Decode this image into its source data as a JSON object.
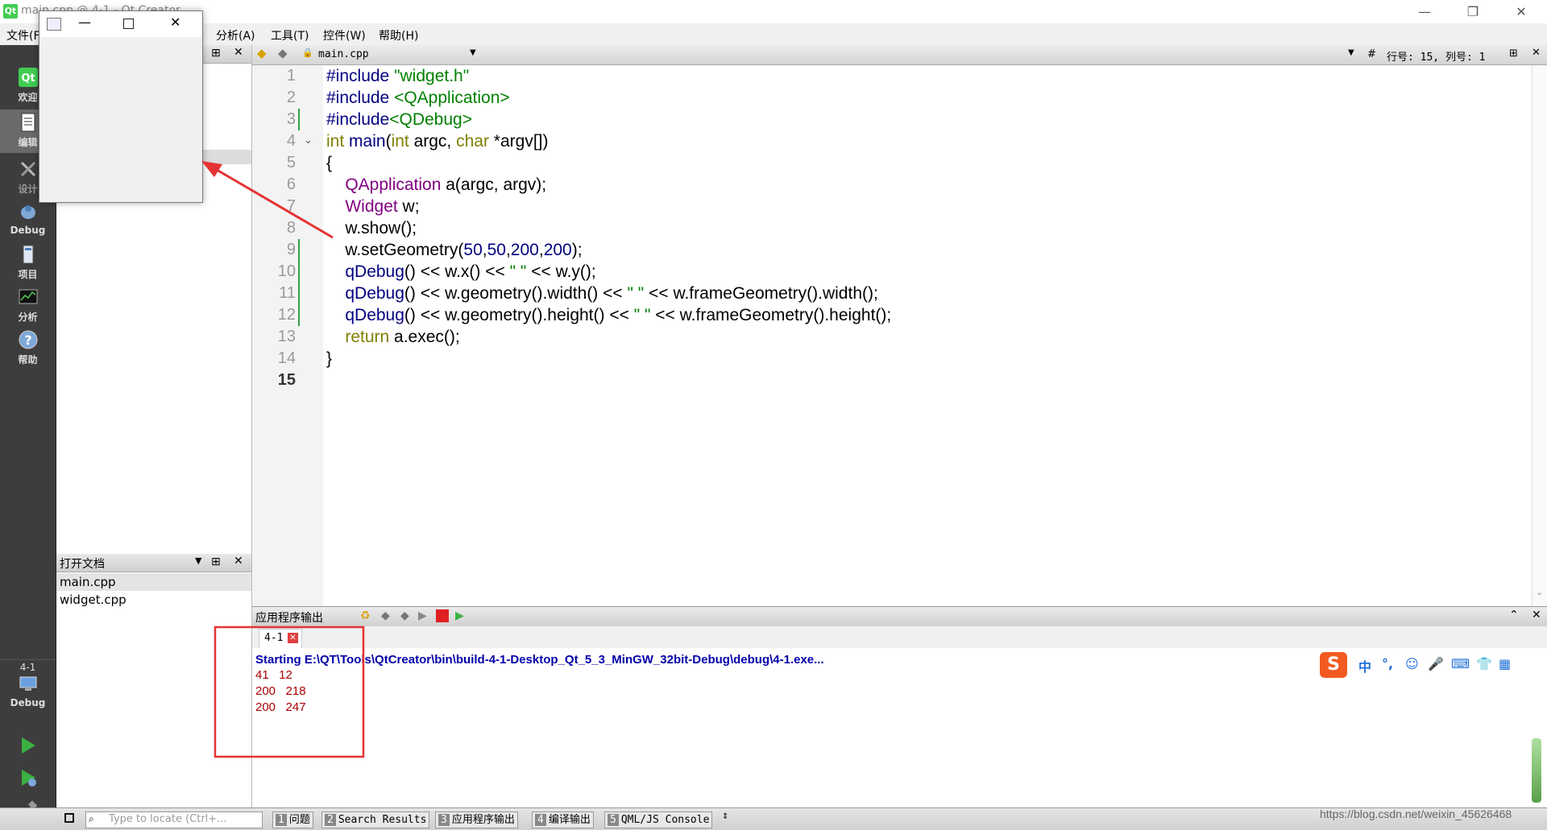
{
  "titlebar": {
    "title": "main.cpp @ 4-1 - Qt Creator",
    "minimize": "—",
    "restore": "❐",
    "close": "✕"
  },
  "menubar": {
    "items": [
      "文件(F)",
      "分析(A)",
      "工具(T)",
      "控件(W)",
      "帮助(H)"
    ]
  },
  "modebar": {
    "modes": [
      "欢迎",
      "编辑",
      "设计",
      "Debug",
      "项目",
      "分析",
      "帮助"
    ],
    "active": "编辑",
    "target": {
      "project": "4-1",
      "config": "Debug"
    }
  },
  "sidebar": {
    "open_docs_title": "打开文档",
    "open_docs": [
      "main.cpp",
      "widget.cpp"
    ]
  },
  "editor": {
    "file_name": "main.cpp",
    "cursor_label": "行号: 15, 列号: 1",
    "line_numbers": [
      "1",
      "2",
      "3",
      "4",
      "5",
      "6",
      "7",
      "8",
      "9",
      "10",
      "11",
      "12",
      "13",
      "14",
      "15"
    ]
  },
  "output": {
    "pane_title": "应用程序输出",
    "tab_label": "4-1",
    "start_line": "Starting E:\\QT\\Tools\\QtCreator\\bin\\build-4-1-Desktop_Qt_5_3_MinGW_32bit-Debug\\debug\\4-1.exe...",
    "lines": [
      "41   12",
      "200   218",
      "200   247"
    ]
  },
  "statusbar": {
    "locate_placeholder": "Type to locate (Ctrl+...",
    "buttons": [
      {
        "num": "1",
        "label": "问题"
      },
      {
        "num": "2",
        "label": "Search Results"
      },
      {
        "num": "3",
        "label": "应用程序输出"
      },
      {
        "num": "4",
        "label": "编译输出"
      },
      {
        "num": "5",
        "label": "QML/JS Console"
      }
    ]
  },
  "ime": {
    "glyphs": [
      "中",
      "°,",
      "☺",
      "🎤",
      "⌨",
      "👕",
      "▦"
    ]
  },
  "watermark": "https://blog.csdn.net/weixin_45626468",
  "colors": {
    "annotation_red": "#e53333",
    "output_blue": "#0000aa",
    "output_red": "#aa0000"
  }
}
